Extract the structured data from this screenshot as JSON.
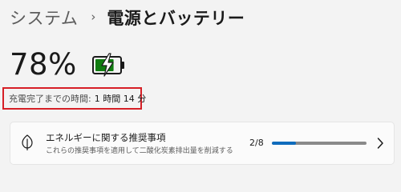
{
  "breadcrumb": {
    "parent": "システム",
    "separator": "›",
    "current": "電源とバッテリー"
  },
  "battery": {
    "percent_text": "78%",
    "level": 0.78,
    "charging": true,
    "icon": "battery-charging-icon",
    "icon_color": "#107c10"
  },
  "charge": {
    "label": "充電完了までの時間:",
    "value": "1 時間 14 分",
    "highlight_color": "#d61f26"
  },
  "recommendation": {
    "icon": "leaf-icon",
    "title": "エネルギーに関する推奨事項",
    "description": "これらの推奨事項を適用して二酸化炭素排出量を削減する",
    "progress_text": "2/8",
    "progress_fraction": 0.25,
    "progress_color": "#0f6cbd",
    "chevron_icon": "chevron-right-icon"
  }
}
